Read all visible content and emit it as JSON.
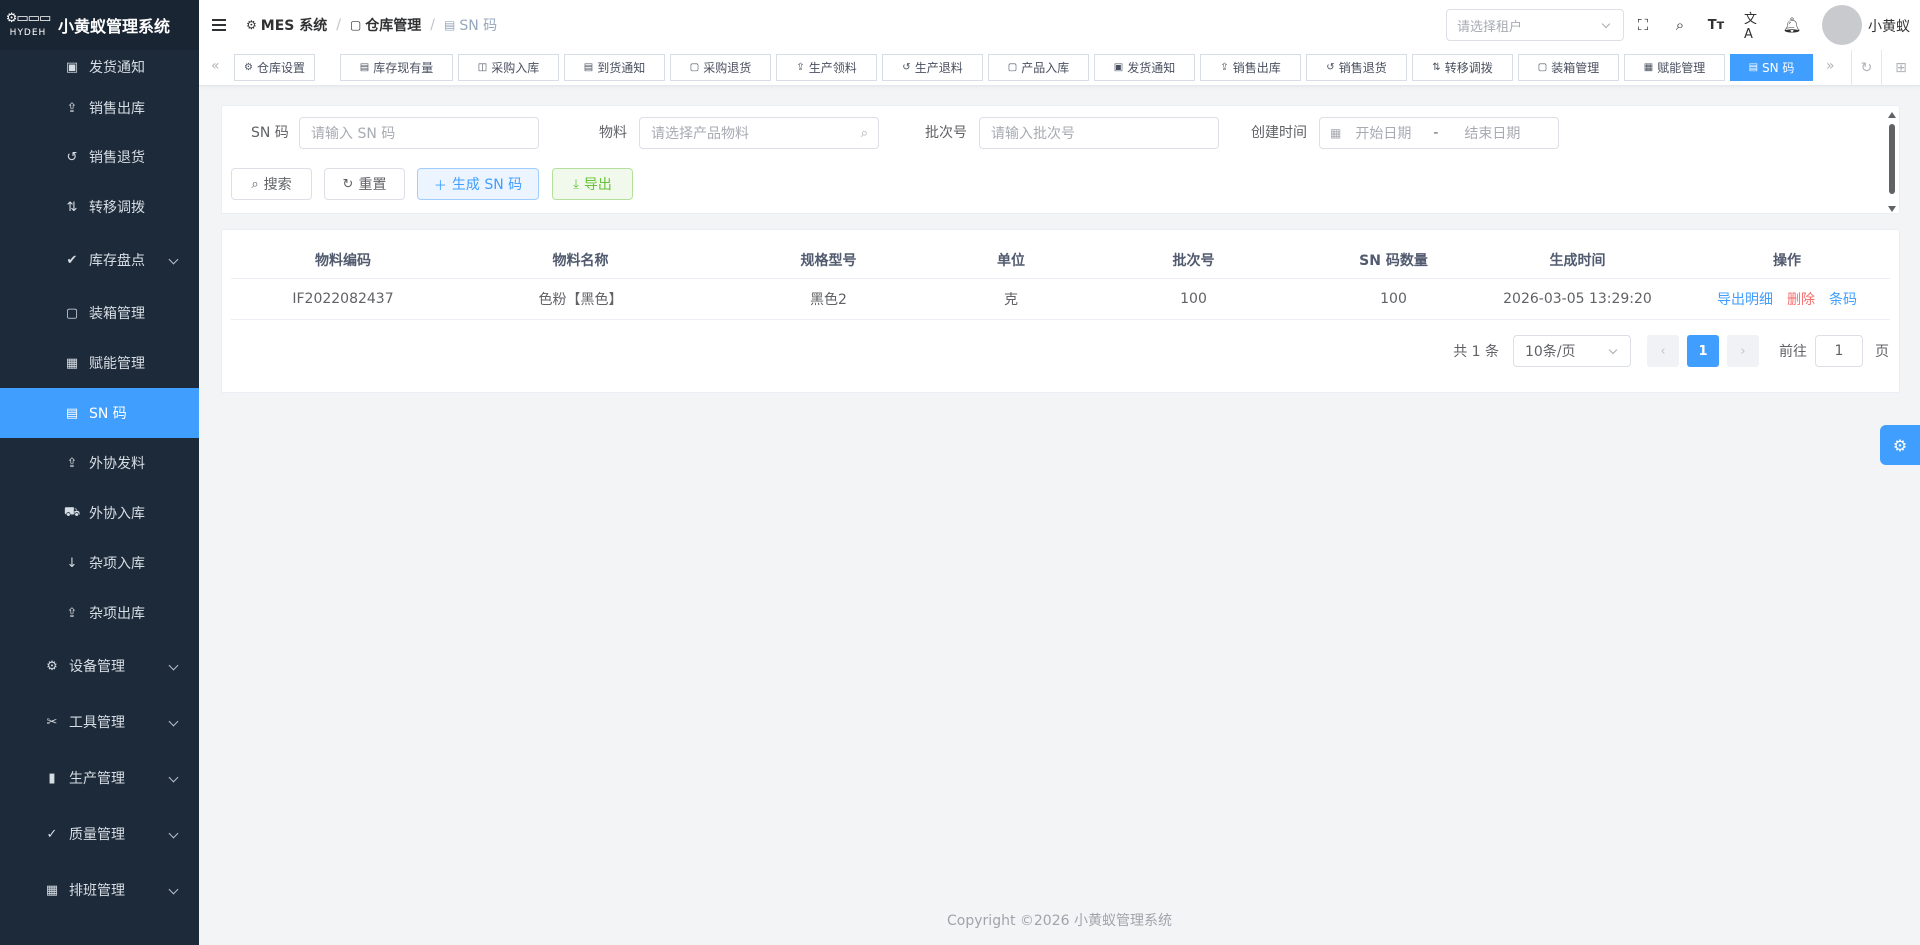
{
  "app": {
    "title": "小黄蚁管理系统",
    "brand_small": "HYDEH"
  },
  "sidebar": {
    "items": [
      {
        "label": "发货通知",
        "icon": "clipboard-icon",
        "active": false,
        "level": "sub"
      },
      {
        "label": "销售出库",
        "icon": "box-out-icon",
        "active": false,
        "level": "sub"
      },
      {
        "label": "销售退货",
        "icon": "return-icon",
        "active": false,
        "level": "sub"
      },
      {
        "label": "转移调拨",
        "icon": "transfer-icon",
        "active": false,
        "level": "sub"
      },
      {
        "label": "库存盘点",
        "icon": "check-circle-icon",
        "active": false,
        "level": "group",
        "expandable": true
      },
      {
        "label": "装箱管理",
        "icon": "package-icon",
        "active": false,
        "level": "sub"
      },
      {
        "label": "赋能管理",
        "icon": "qrcode-icon",
        "active": false,
        "level": "sub"
      },
      {
        "label": "SN 码",
        "icon": "document-icon",
        "active": true,
        "level": "sub"
      },
      {
        "label": "外协发料",
        "icon": "box-out-icon",
        "active": false,
        "level": "sub"
      },
      {
        "label": "外协入库",
        "icon": "truck-icon",
        "active": false,
        "level": "sub"
      },
      {
        "label": "杂项入库",
        "icon": "arrow-down-icon",
        "active": false,
        "level": "sub"
      },
      {
        "label": "杂项出库",
        "icon": "box-out-icon",
        "active": false,
        "level": "sub"
      },
      {
        "label": "设备管理",
        "icon": "cpu-icon",
        "active": false,
        "level": "top",
        "expandable": true
      },
      {
        "label": "工具管理",
        "icon": "scissors-icon",
        "active": false,
        "level": "top",
        "expandable": true
      },
      {
        "label": "生产管理",
        "icon": "bar-chart-icon",
        "active": false,
        "level": "top",
        "expandable": true
      },
      {
        "label": "质量管理",
        "icon": "check-icon",
        "active": false,
        "level": "top",
        "expandable": true
      },
      {
        "label": "排班管理",
        "icon": "calendar-icon",
        "active": false,
        "level": "top",
        "expandable": true
      }
    ]
  },
  "header": {
    "breadcrumb": [
      {
        "label": "MES 系统",
        "icon": "cpu-icon"
      },
      {
        "label": "仓库管理",
        "icon": "package-icon"
      },
      {
        "label": "SN 码",
        "icon": "document-icon"
      }
    ],
    "tenant_placeholder": "请选择租户",
    "username": "小黄蚁"
  },
  "tags": [
    {
      "label": "仓库设置",
      "icon": "settings-icon",
      "active": false
    },
    {
      "label": "库存现有量",
      "icon": "document-icon",
      "active": false
    },
    {
      "label": "采购入库",
      "icon": "bag-icon",
      "active": false
    },
    {
      "label": "到货通知",
      "icon": "document-icon",
      "active": false
    },
    {
      "label": "采购退货",
      "icon": "package-icon",
      "active": false
    },
    {
      "label": "生产领料",
      "icon": "box-out-icon",
      "active": false
    },
    {
      "label": "生产退料",
      "icon": "return-icon",
      "active": false
    },
    {
      "label": "产品入库",
      "icon": "package-icon",
      "active": false
    },
    {
      "label": "发货通知",
      "icon": "clipboard-icon",
      "active": false
    },
    {
      "label": "销售出库",
      "icon": "box-out-icon",
      "active": false
    },
    {
      "label": "销售退货",
      "icon": "return-icon",
      "active": false
    },
    {
      "label": "转移调拨",
      "icon": "transfer-icon",
      "active": false
    },
    {
      "label": "装箱管理",
      "icon": "package-icon",
      "active": false
    },
    {
      "label": "赋能管理",
      "icon": "qrcode-icon",
      "active": false
    },
    {
      "label": "SN 码",
      "icon": "document-icon",
      "active": true
    }
  ],
  "search": {
    "sn_label": "SN 码",
    "sn_placeholder": "请输入 SN 码",
    "material_label": "物料",
    "material_placeholder": "请选择产品物料",
    "batch_label": "批次号",
    "batch_placeholder": "请输入批次号",
    "created_label": "创建时间",
    "start_placeholder": "开始日期",
    "range_sep": "-",
    "end_placeholder": "结束日期",
    "search_btn": "搜索",
    "reset_btn": "重置",
    "generate_btn": "生成 SN 码",
    "export_btn": "导出"
  },
  "table": {
    "columns": [
      "物料编码",
      "物料名称",
      "规格型号",
      "单位",
      "批次号",
      "SN 码数量",
      "生成时间",
      "操作"
    ],
    "rows": [
      {
        "code": "IF2022082437",
        "name": "色粉【黑色】",
        "spec": "黑色2",
        "unit": "克",
        "batch": "100",
        "sn_count": "100",
        "created": "2026-03-05 13:29:20",
        "ops": {
          "export_detail": "导出明细",
          "delete": "删除",
          "barcode": "条码"
        }
      }
    ]
  },
  "pager": {
    "total": "共 1 条",
    "page_size": "10条/页",
    "current_page": "1",
    "goto_label": "前往",
    "goto_value": "1",
    "page_suffix": "页"
  },
  "footer": {
    "copyright": "Copyright ©2026 小黄蚁管理系统"
  },
  "colors": {
    "primary": "#409eff",
    "sidebar_bg": "#1d2a3a",
    "danger": "#f56c6c",
    "success": "#67c23a"
  }
}
